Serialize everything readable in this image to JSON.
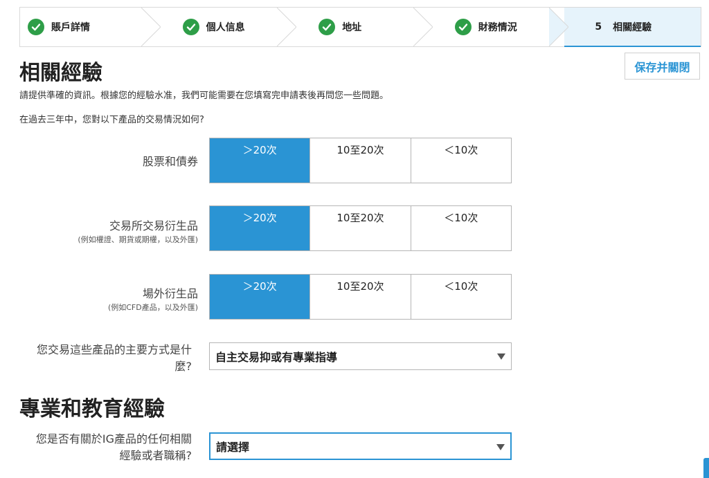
{
  "stepper": {
    "steps": [
      {
        "label": "賬戶詳情"
      },
      {
        "label": "個人信息"
      },
      {
        "label": "地址"
      },
      {
        "label": "財務情況"
      },
      {
        "number": "5",
        "label": "相關經驗"
      }
    ]
  },
  "page": {
    "title": "相關經驗",
    "save_label": "保存并關閉",
    "intro": "請提供準確的資訊。根據您的經驗水准，我們可能需要在您填寫完申請表後再問您一些問題。",
    "question": "在過去三年中，您對以下產品的交易情況如何?"
  },
  "rows": [
    {
      "label": "股票和債券",
      "sub": "",
      "options": [
        "＞20次",
        "10至20次",
        "＜10次"
      ],
      "selected": "＞20次"
    },
    {
      "label": "交易所交易衍生品",
      "sub": "(例如權證、期貨或期權，以及外匯)",
      "options": [
        "＞20次",
        "10至20次",
        "＜10次"
      ],
      "selected": "＞20次"
    },
    {
      "label": "場外衍生品",
      "sub": "(例如CFD產品，以及外匯)",
      "options": [
        "＞20次",
        "10至20次",
        "＜10次"
      ],
      "selected": "＞20次"
    }
  ],
  "trade_mode": {
    "label_line1": "您交易這些產品的主要方式是什",
    "label_line2": "麼?",
    "value": "自主交易抑或有專業指導"
  },
  "section2": {
    "title": "專業和教育經驗",
    "label_line1": "您是否有關於IG產品的任何相關",
    "label_line2": "經驗或者職稱?",
    "value": "請選擇"
  },
  "colors": {
    "accent": "#2a94d4",
    "success": "#2e9e48"
  }
}
